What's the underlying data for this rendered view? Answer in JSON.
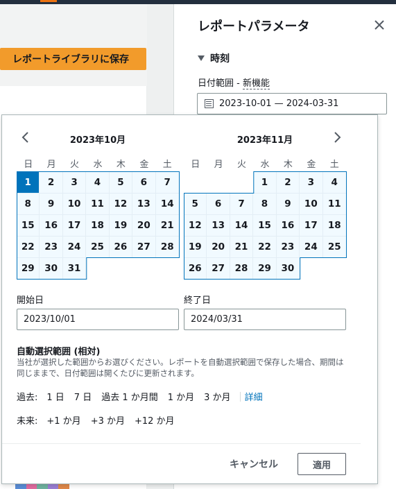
{
  "background": {
    "save_button_label": "レポートライブラリに保存",
    "swatch_colors": [
      "#5a8dd6",
      "#e06c9f",
      "#6fb3a0",
      "#9b7fd4",
      "#e0894a"
    ]
  },
  "panel": {
    "title": "レポートパラメータ",
    "section_label": "時刻",
    "field_label": "日付範囲",
    "field_label_sep": " - ",
    "new_feature_label": "新機能",
    "range_value": "2023-10-01 — 2024-03-31"
  },
  "calendar": {
    "weekday_labels": [
      "日",
      "月",
      "火",
      "水",
      "木",
      "金",
      "土"
    ],
    "left_month": {
      "title": "2023年10月",
      "weeks": [
        [
          "1",
          "2",
          "3",
          "4",
          "5",
          "6",
          "7"
        ],
        [
          "8",
          "9",
          "10",
          "11",
          "12",
          "13",
          "14"
        ],
        [
          "15",
          "16",
          "17",
          "18",
          "19",
          "20",
          "21"
        ],
        [
          "22",
          "23",
          "24",
          "25",
          "26",
          "27",
          "28"
        ],
        [
          "29",
          "30",
          "31",
          "",
          "",
          "",
          ""
        ]
      ]
    },
    "right_month": {
      "title": "2023年11月",
      "weeks": [
        [
          "",
          "",
          "",
          "1",
          "2",
          "3",
          "4"
        ],
        [
          "5",
          "6",
          "7",
          "8",
          "9",
          "10",
          "11"
        ],
        [
          "12",
          "13",
          "14",
          "15",
          "16",
          "17",
          "18"
        ],
        [
          "19",
          "20",
          "21",
          "22",
          "23",
          "24",
          "25"
        ],
        [
          "26",
          "27",
          "28",
          "29",
          "30",
          "",
          ""
        ]
      ]
    },
    "selected_day": "1",
    "accent_color": "#0073bb"
  },
  "inputs": {
    "start_label": "開始日",
    "start_value": "2023/10/01",
    "end_label": "終了日",
    "end_value": "2024/03/31"
  },
  "relative": {
    "title": "自動選択範囲 (相対)",
    "description": "当社が選択した範囲からお選びください。レポートを自動選択範囲で保存した場合、期間は同じままで、日付範囲は開くたびに更新されます。",
    "past_label": "過去:",
    "past_options": [
      "1 日",
      "7 日",
      "過去 1 か月間",
      "1 か月",
      "3 か月"
    ],
    "details_link": "詳細",
    "future_label": "未来:",
    "future_options": [
      "+1 か月",
      "+3 か月",
      "+12 か月"
    ]
  },
  "footer": {
    "cancel_label": "キャンセル",
    "apply_label": "適用"
  }
}
